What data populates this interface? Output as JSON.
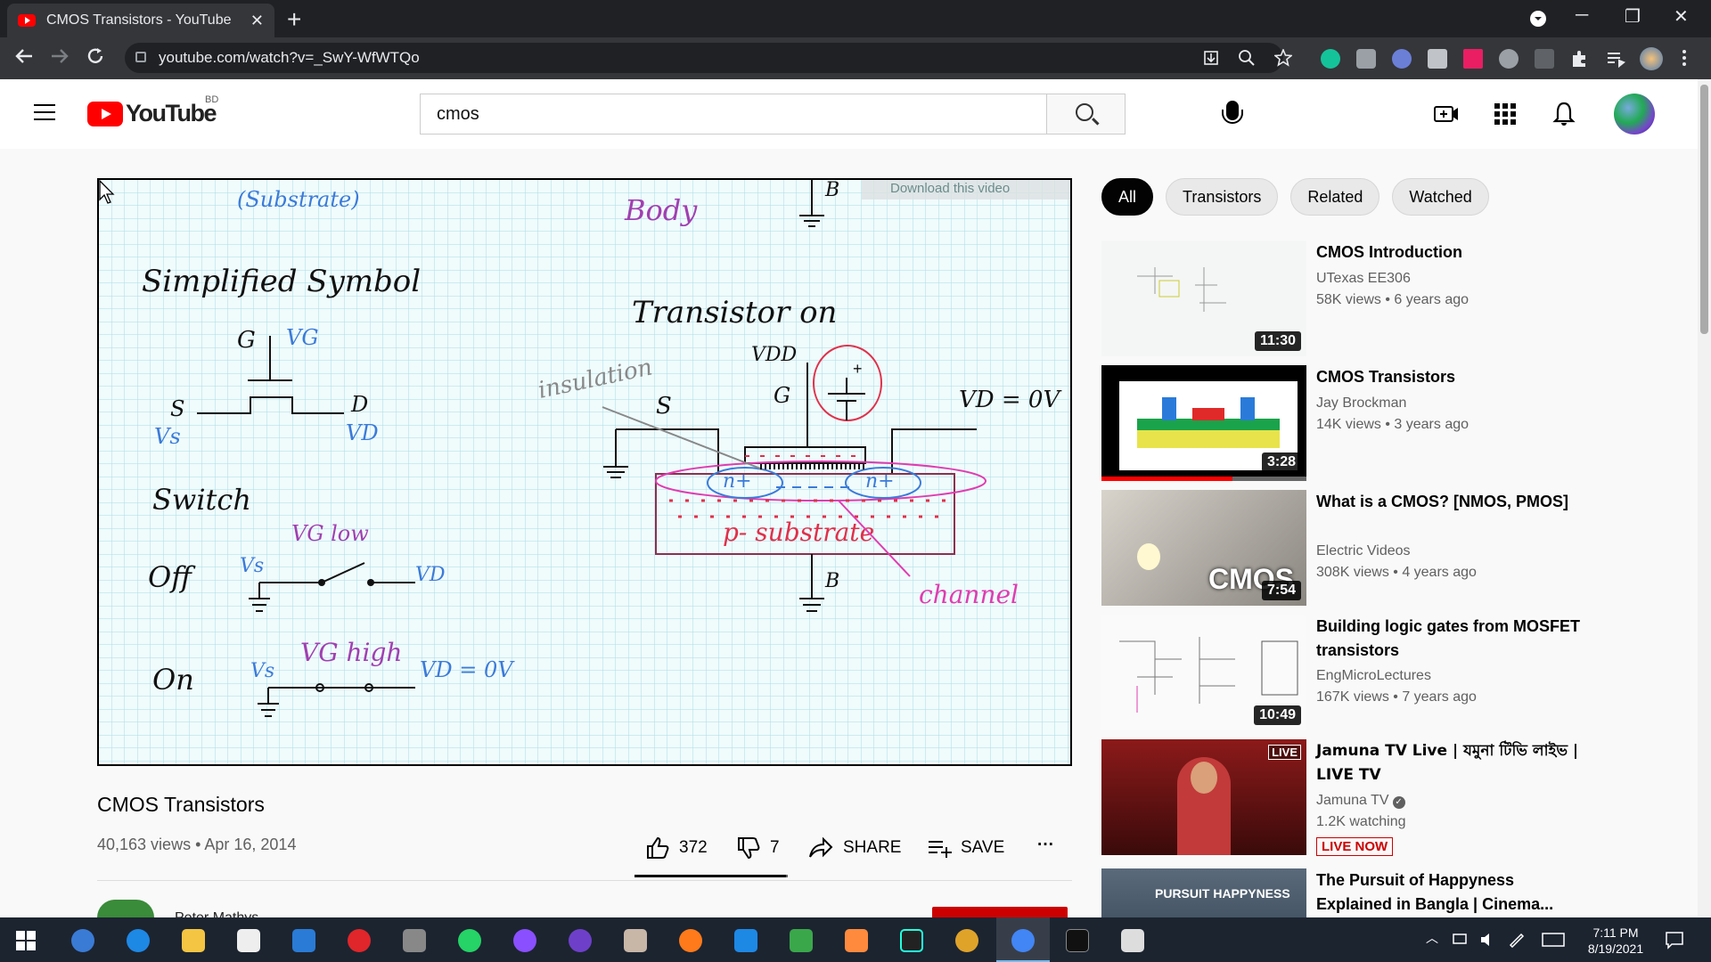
{
  "browser": {
    "tab_title": "CMOS Transistors - YouTube",
    "tab_close": "✕",
    "new_tab": "+",
    "url": "youtube.com/watch?v=_SwY-WfWTQo",
    "window_controls": {
      "minimize": "─",
      "restore": "❐",
      "close": "✕"
    }
  },
  "masthead": {
    "logo_text": "YouTube",
    "country_code": "BD",
    "search_value": "cmos"
  },
  "video": {
    "download_overlay": "Download this video",
    "title": "CMOS Transistors",
    "meta": "40,163 views • Apr 16, 2014",
    "likes": "372",
    "dislikes": "7",
    "share_label": "SHARE",
    "save_label": "SAVE",
    "more_label": "···",
    "like_ratio": 0.98,
    "channel_name": "Peter Mathys",
    "whiteboard": {
      "substrate": "(Substrate)",
      "body": "Body",
      "b_top": "B",
      "simplified": "Simplified Symbol",
      "g": "G",
      "vg": "VG",
      "s": "S",
      "d": "D",
      "vs": "Vs",
      "vd": "VD",
      "switch": "Switch",
      "vg_low": "VG low",
      "off": "Off",
      "vs2": "Vs",
      "vd2": "VD",
      "vg_high": "VG high",
      "on": "On",
      "vs3": "Vs",
      "vd_zero": "VD = 0V",
      "transistor_on": "Transistor on",
      "vdd": "VDD",
      "g2": "G",
      "s2": "S",
      "insulation": "insulation",
      "vd_eq": "VD = 0V",
      "nplus1": "n+",
      "nplus2": "n+",
      "psub": "p- substrate",
      "b_bottom": "B",
      "channel": "channel"
    }
  },
  "chips": [
    "All",
    "Transistors",
    "Related",
    "Watched"
  ],
  "recommendations": [
    {
      "title": "CMOS Introduction",
      "channel": "UTexas EE306",
      "stats": "58K views • 6 years ago",
      "duration": "11:30"
    },
    {
      "title": "CMOS Transistors",
      "channel": "Jay Brockman",
      "stats": "14K views • 3 years ago",
      "duration": "3:28",
      "watched_fraction": 0.64
    },
    {
      "title": "What is a CMOS? [NMOS, PMOS]",
      "channel": "Electric Videos",
      "stats": "308K views • 4 years ago",
      "duration": "7:54",
      "thumb_text": "CMOS"
    },
    {
      "title": "Building logic gates from MOSFET transistors",
      "channel": "EngMicroLectures",
      "stats": "167K views • 7 years ago",
      "duration": "10:49"
    },
    {
      "title": "Jamuna TV Live | যমুনা টিভি লাইভ | LIVE TV",
      "channel": "Jamuna TV",
      "stats": "1.2K watching",
      "badge": "LIVE NOW",
      "thumb_badge": "LIVE"
    },
    {
      "title": "The Pursuit of Happyness Explained in Bangla | Cinema...",
      "thumb_text": "PURSUIT HAPPYNESS"
    }
  ],
  "taskbar": {
    "time": "7:11 PM",
    "date": "8/19/2021"
  }
}
